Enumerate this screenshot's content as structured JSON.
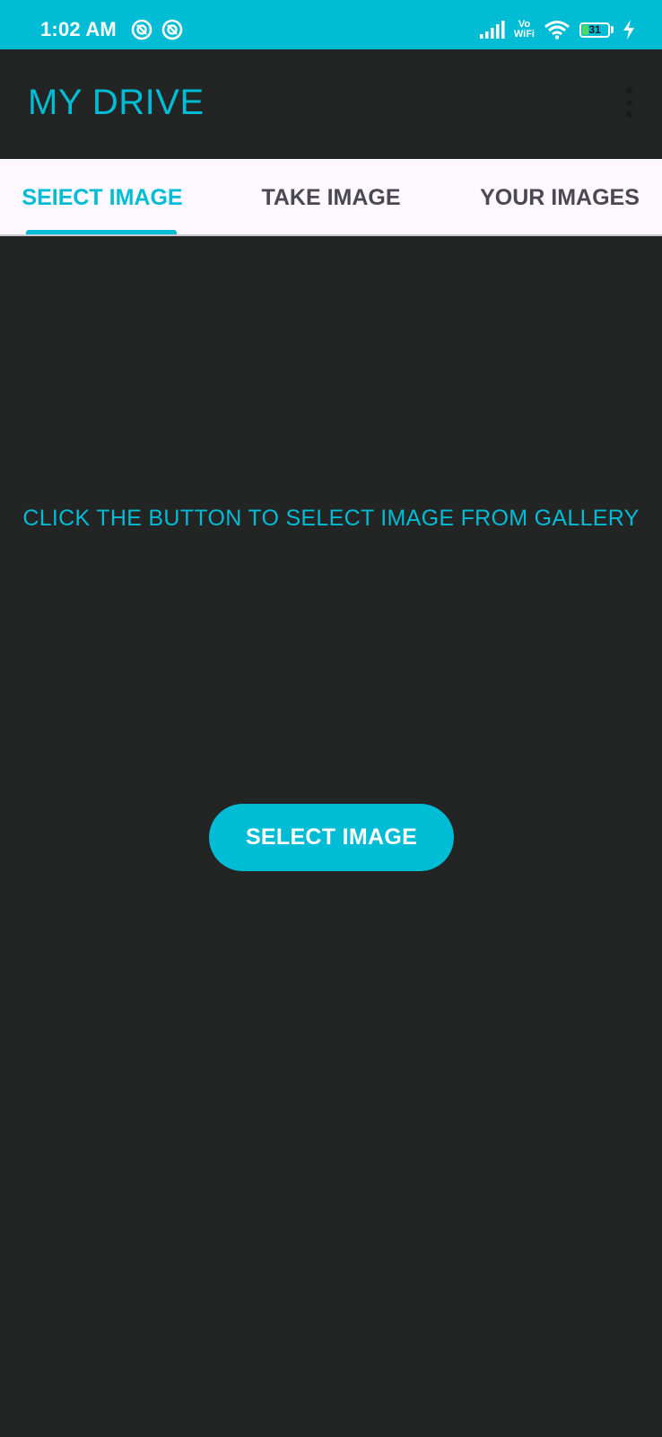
{
  "status_bar": {
    "time": "1:02 AM",
    "left_icons": [
      "notification-app-icon",
      "notification-app-icon"
    ],
    "right_icons": [
      "signal-icon",
      "vowifi-icon",
      "wifi-icon",
      "battery-icon",
      "charging-icon"
    ],
    "vowifi_top": "Vo",
    "vowifi_bottom": "WiFi",
    "battery_percent": "31",
    "battery_level": 0.31
  },
  "app_bar": {
    "title": "MY DRIVE",
    "menu_icon": "more-vert-icon"
  },
  "tabs": [
    {
      "label": "SEIECT IMAGE",
      "active": true
    },
    {
      "label": "TAKE IMAGE",
      "active": false
    },
    {
      "label": "YOUR IMAGES",
      "active": false
    }
  ],
  "content": {
    "instruction": "CLICK THE BUTTON TO SELECT IMAGE FROM GALLERY",
    "button_label": "SELECT IMAGE"
  },
  "colors": {
    "accent": "#00BCD4",
    "background": "#232424",
    "tab_background": "#FDF7FF",
    "tab_inactive_text": "#4A4850",
    "battery_fill": "#4CD964"
  }
}
